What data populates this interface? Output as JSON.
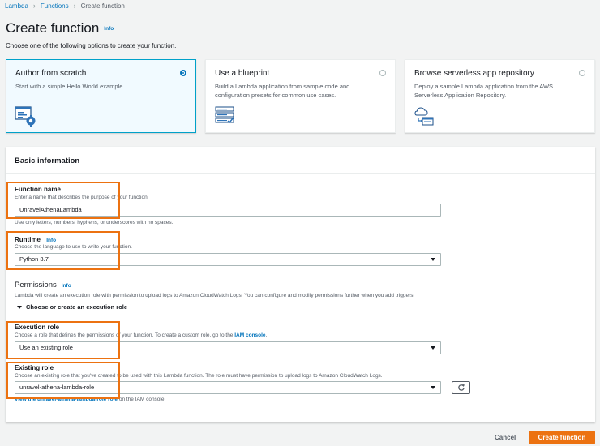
{
  "breadcrumb": {
    "items": [
      "Lambda",
      "Functions"
    ],
    "current": "Create function"
  },
  "page": {
    "title": "Create function",
    "info": "Info",
    "subtitle": "Choose one of the following options to create your function."
  },
  "options": [
    {
      "title": "Author from scratch",
      "description": "Start with a simple Hello World example.",
      "selected": true,
      "icon": "code-editor-icon"
    },
    {
      "title": "Use a blueprint",
      "description": "Build a Lambda application from sample code and configuration presets for common use cases.",
      "selected": false,
      "icon": "blueprint-checklist-icon"
    },
    {
      "title": "Browse serverless app repository",
      "description": "Deploy a sample Lambda application from the AWS Serverless Application Repository.",
      "selected": false,
      "icon": "cloud-repository-icon"
    }
  ],
  "basic": {
    "header": "Basic information",
    "function_name": {
      "label": "Function name",
      "description": "Enter a name that describes the purpose of your function.",
      "value": "UnravelAthenaLambda",
      "hint": "Use only letters, numbers, hyphens, or underscores with no spaces."
    },
    "runtime": {
      "label": "Runtime",
      "info": "Info",
      "description": "Choose the language to use to write your function.",
      "value": "Python 3.7"
    },
    "permissions": {
      "title": "Permissions",
      "info": "Info",
      "description": "Lambda will create an execution role with permission to upload logs to Amazon CloudWatch Logs. You can configure and modify permissions further when you add triggers.",
      "expander": "Choose or create an execution role"
    },
    "execution_role": {
      "label": "Execution role",
      "description_prefix": "Choose a role that defines the permissions of your function. To create a custom role, go to the ",
      "description_link": "IAM console",
      "description_suffix": ".",
      "value": "Use an existing role"
    },
    "existing_role": {
      "label": "Existing role",
      "description": "Choose an existing role that you've created to be used with this Lambda function. The role must have permission to upload logs to Amazon CloudWatch Logs.",
      "value": "unravel-athena-lambda-role",
      "view_link": "View the unravel-athena-lambda-role role",
      "view_suffix": " on the IAM console."
    }
  },
  "footer": {
    "cancel": "Cancel",
    "create": "Create function"
  },
  "colors": {
    "accent": "#ec7211",
    "link": "#0073bb",
    "selected_border": "#00a1c9"
  }
}
